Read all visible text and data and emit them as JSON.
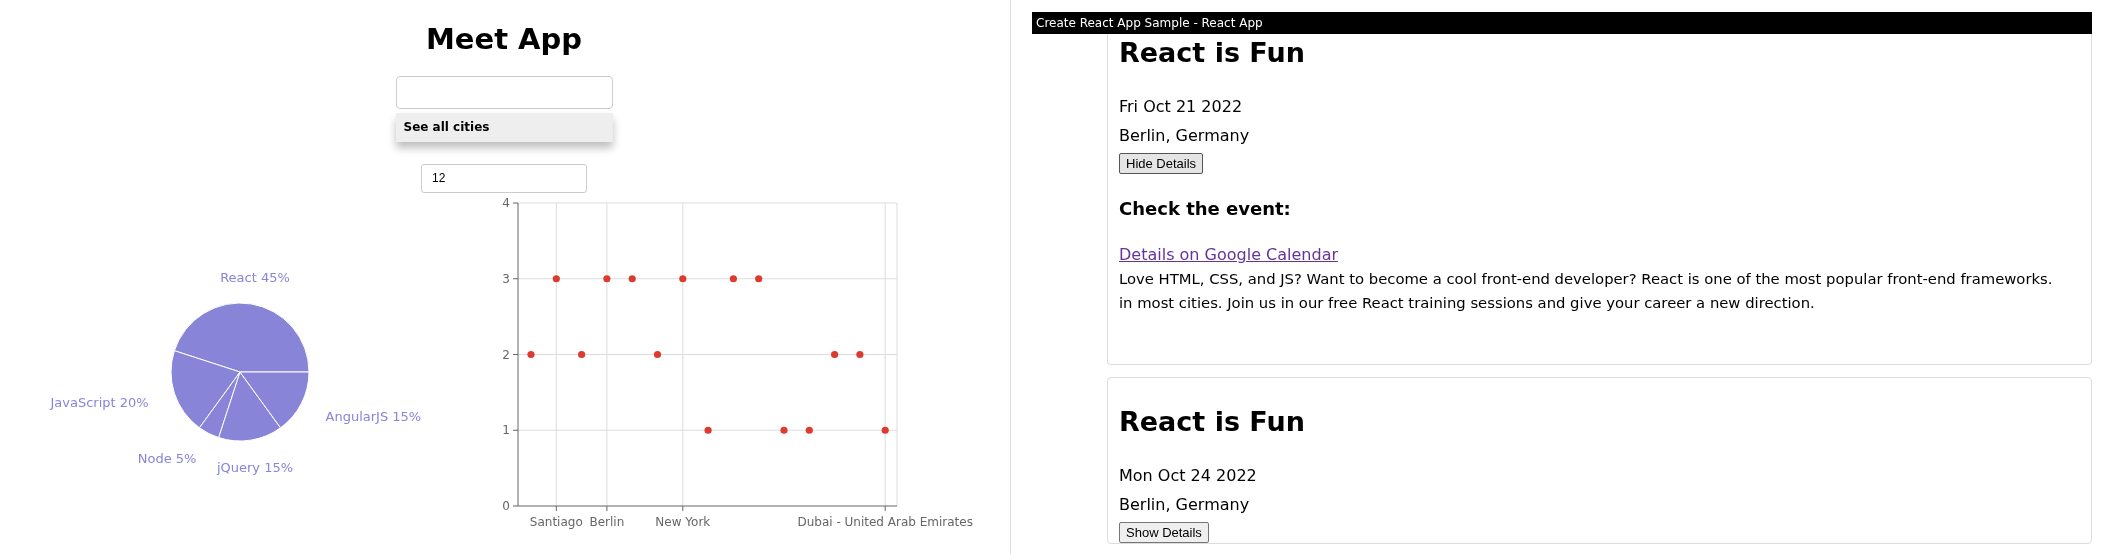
{
  "app": {
    "title": "Meet App"
  },
  "city_search": {
    "suggestions": [
      {
        "label": "See all cities"
      }
    ]
  },
  "number_of_events": {
    "value": "12"
  },
  "pie": {
    "chart_data": {
      "type": "pie",
      "categories": [
        "React",
        "JavaScript",
        "Node",
        "jQuery",
        "AngularJS"
      ],
      "series": [
        {
          "color": "#8884d8",
          "values": [
            45,
            20,
            5,
            15,
            15
          ]
        }
      ],
      "value_labels": [
        "45%",
        "20%",
        "5%",
        "15%",
        "15%"
      ]
    }
  },
  "scatter": {
    "chart_data": {
      "type": "scatter",
      "categories": [
        null,
        "Santiago",
        null,
        "Berlin",
        null,
        null,
        "New York",
        null,
        null,
        null,
        null,
        null,
        null,
        null,
        "Dubai - United Arab Emirates"
      ],
      "series": [
        {
          "color": "#dc3b2f",
          "values": [
            2,
            3,
            2,
            3,
            3,
            2,
            3,
            1,
            3,
            3,
            1,
            1,
            2,
            2,
            1
          ]
        }
      ],
      "ylim": [
        0,
        4
      ],
      "yticks": [
        0,
        1,
        2,
        3,
        4
      ],
      "grid": true
    }
  },
  "preview_window": {
    "title": "Create React App Sample - React App",
    "events": [
      {
        "title": "React is Fun",
        "date": "Fri Oct 21 2022",
        "location": "Berlin, Germany",
        "button": "Hide Details",
        "expanded": true,
        "details_heading": "Check the event:",
        "link": "Details on Google Calendar",
        "description_lines": [
          "Love HTML, CSS, and JS? Want to become a cool front-end developer? React is one of the most popular front-end frameworks.",
          "in most cities. Join us in our free React training sessions and give your career a new direction."
        ]
      },
      {
        "title": "React is Fun",
        "date": "Mon Oct 24 2022",
        "location": "Berlin, Germany",
        "button": "Show Details",
        "expanded": false
      }
    ]
  }
}
